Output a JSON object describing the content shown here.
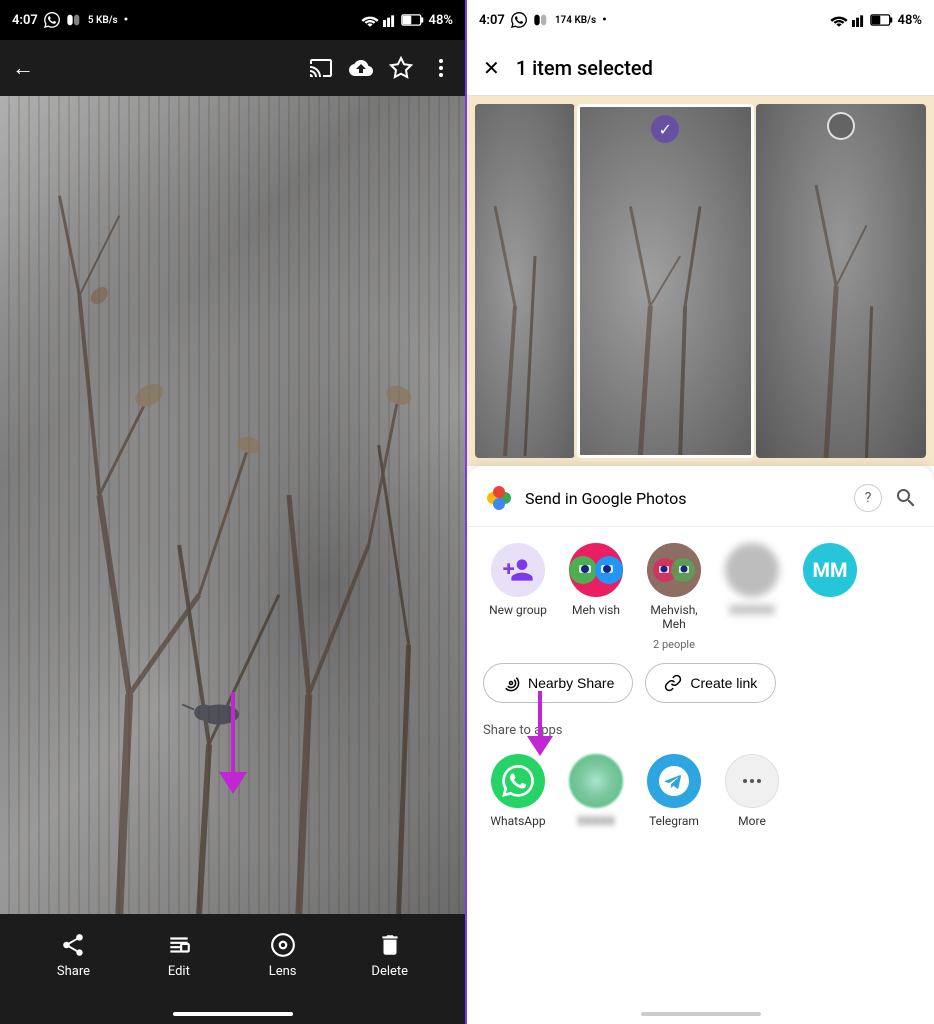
{
  "left": {
    "status_bar": {
      "time": "4:07",
      "battery": "48%",
      "signal": "▲4"
    },
    "top_bar": {
      "back_icon": "←",
      "cast_icon": "cast",
      "upload_icon": "upload",
      "star_icon": "★",
      "menu_icon": "⋮"
    },
    "bottom_actions": [
      {
        "label": "Share",
        "icon": "share"
      },
      {
        "label": "Edit",
        "icon": "edit"
      },
      {
        "label": "Lens",
        "icon": "lens"
      },
      {
        "label": "Delete",
        "icon": "delete"
      }
    ]
  },
  "right": {
    "status_bar": {
      "time": "4:07",
      "battery": "48%"
    },
    "top_bar": {
      "close_icon": "✕",
      "title": "1 item selected"
    },
    "send_google_photos": {
      "label": "Send in Google Photos",
      "help_icon": "?",
      "search_icon": "search"
    },
    "contacts": [
      {
        "name": "New group",
        "sub": "",
        "type": "new-group"
      },
      {
        "name": "Meh vish",
        "sub": "",
        "type": "meh-vish"
      },
      {
        "name": "Mehvish, Meh",
        "sub": "2 people",
        "type": "mehvish-meh"
      },
      {
        "name": "",
        "sub": "",
        "type": "blurred"
      },
      {
        "name": "MM",
        "sub": "",
        "type": "mm"
      }
    ],
    "buttons": [
      {
        "label": "Nearby Share",
        "icon": "nearby"
      },
      {
        "label": "Create link",
        "icon": "link"
      }
    ],
    "share_to_apps_label": "Share to apps",
    "apps": [
      {
        "name": "WhatsApp",
        "type": "whatsapp"
      },
      {
        "name": "",
        "type": "google-nearby"
      },
      {
        "name": "Telegram",
        "type": "telegram"
      },
      {
        "name": "More",
        "type": "more"
      }
    ]
  }
}
